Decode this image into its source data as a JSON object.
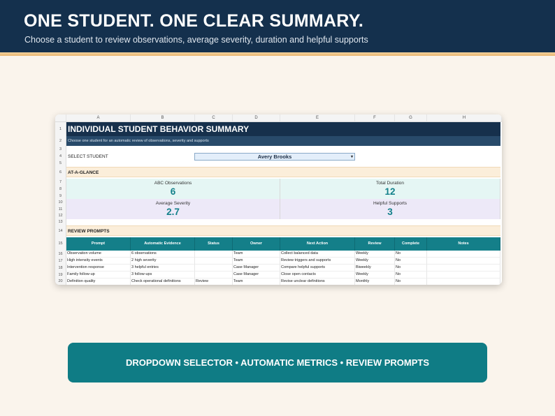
{
  "banner": {
    "title": "ONE STUDENT. ONE CLEAR SUMMARY.",
    "subtitle": "Choose a student to review observations, average severity, duration and helpful supports"
  },
  "sheet": {
    "columns": [
      "A",
      "B",
      "C",
      "D",
      "E",
      "F",
      "G",
      "H"
    ],
    "rows": [
      "1",
      "2",
      "3",
      "4",
      "5",
      "6",
      "7",
      "8",
      "9",
      "10",
      "11",
      "12",
      "13",
      "14",
      "15",
      "16",
      "17",
      "18",
      "19",
      "20"
    ],
    "title": "INDIVIDUAL STUDENT BEHAVIOR SUMMARY",
    "subtitle": "Choose one student for an automatic review of observations, severity and supports",
    "select_label": "SELECT STUDENT",
    "selected_student": "Avery Brooks",
    "at_a_glance": "AT-A-GLANCE",
    "metrics": {
      "abc_label": "ABC Observations",
      "abc_value": "6",
      "duration_label": "Total Duration",
      "duration_value": "12",
      "severity_label": "Average Severity",
      "severity_value": "2.7",
      "supports_label": "Helpful Supports",
      "supports_value": "3"
    },
    "review_prompts": "REVIEW PROMPTS",
    "table_headers": [
      "Prompt",
      "Automatic Evidence",
      "Status",
      "Owner",
      "Next Action",
      "Review",
      "Complete",
      "Notes"
    ],
    "table_rows": [
      [
        "Observation volume",
        "6 observations",
        "",
        "Team",
        "Collect balanced data",
        "Weekly",
        "No",
        ""
      ],
      [
        "High intensity events",
        "2 high severity",
        "",
        "Team",
        "Review triggers and supports",
        "Weekly",
        "No",
        ""
      ],
      [
        "Intervention response",
        "3 helpful entries",
        "",
        "Case Manager",
        "Compare helpful supports",
        "Biweekly",
        "No",
        ""
      ],
      [
        "Family follow-up",
        "3 follow-ups",
        "",
        "Case Manager",
        "Close open contacts",
        "Weekly",
        "No",
        ""
      ],
      [
        "Definition quality",
        "Check operational definitions",
        "Review",
        "Team",
        "Revise unclear definitions",
        "Monthly",
        "No",
        ""
      ]
    ]
  },
  "footer_bar": "DROPDOWN SELECTOR • AUTOMATIC METRICS • REVIEW PROMPTS",
  "colors": {
    "navy": "#14304d",
    "teal": "#0f7c85",
    "cream": "#faf4ec"
  }
}
